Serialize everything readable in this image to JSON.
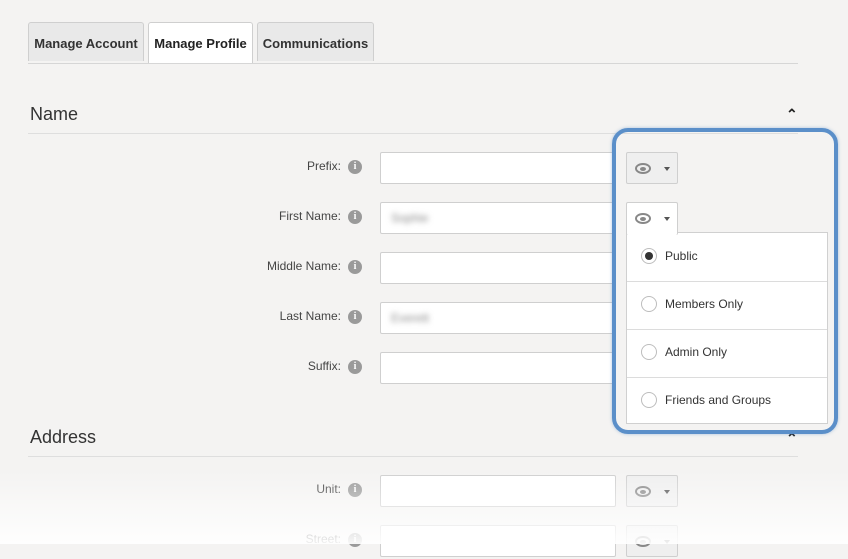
{
  "tabs": [
    {
      "label": "Manage Account"
    },
    {
      "label": "Manage Profile",
      "active": true
    },
    {
      "label": "Communications"
    }
  ],
  "sections": {
    "name": {
      "title": "Name",
      "fields": [
        {
          "label": "Prefix:",
          "value": ""
        },
        {
          "label": "First Name:",
          "value": "Sophie"
        },
        {
          "label": "Middle Name:",
          "value": ""
        },
        {
          "label": "Last Name:",
          "value": "Everett"
        },
        {
          "label": "Suffix:",
          "value": ""
        }
      ]
    },
    "address": {
      "title": "Address",
      "fields": [
        {
          "label": "Unit:",
          "value": ""
        },
        {
          "label": "Street:",
          "value": ""
        }
      ]
    }
  },
  "visibility_menu": {
    "options": [
      {
        "label": "Public",
        "selected": true
      },
      {
        "label": "Members Only",
        "selected": false
      },
      {
        "label": "Admin Only",
        "selected": false
      },
      {
        "label": "Friends and Groups",
        "selected": false
      }
    ]
  },
  "icons": {
    "info": "info-icon",
    "visibility": "eye-icon",
    "dropdown": "caret-down-icon",
    "collapse": "chevron-up-icon"
  },
  "colors": {
    "highlight": "#5b8fc9",
    "background": "#f4f3f2"
  },
  "glyphs": {
    "info": "i",
    "collapse": "⌃"
  }
}
